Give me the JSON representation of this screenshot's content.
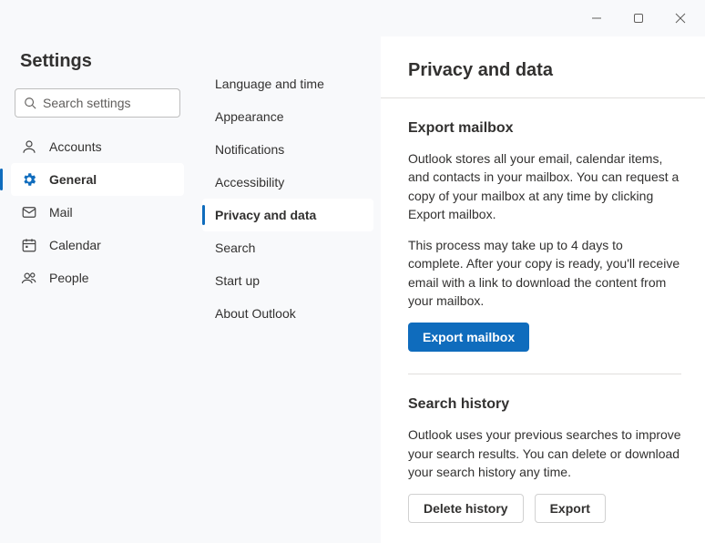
{
  "settings_title": "Settings",
  "search_placeholder": "Search settings",
  "primary_nav": [
    {
      "label": "Accounts",
      "icon": "person"
    },
    {
      "label": "General",
      "icon": "gear",
      "active": true
    },
    {
      "label": "Mail",
      "icon": "mail"
    },
    {
      "label": "Calendar",
      "icon": "calendar"
    },
    {
      "label": "People",
      "icon": "people"
    }
  ],
  "secondary_nav": [
    {
      "label": "Language and time"
    },
    {
      "label": "Appearance"
    },
    {
      "label": "Notifications"
    },
    {
      "label": "Accessibility"
    },
    {
      "label": "Privacy and data",
      "active": true
    },
    {
      "label": "Search"
    },
    {
      "label": "Start up"
    },
    {
      "label": "About Outlook"
    }
  ],
  "page": {
    "title": "Privacy and data",
    "sections": {
      "export": {
        "heading": "Export mailbox",
        "p1": "Outlook stores all your email, calendar items, and contacts in your mailbox. You can request a copy of your mailbox at any time by clicking Export mailbox.",
        "p2": "This process may take up to 4 days to complete. After your copy is ready, you'll receive email with a link to download the content from your mailbox.",
        "button": "Export mailbox"
      },
      "history": {
        "heading": "Search history",
        "p1": "Outlook uses your previous searches to improve your search results. You can delete or download your search history any time.",
        "delete_button": "Delete history",
        "export_button": "Export"
      }
    }
  }
}
